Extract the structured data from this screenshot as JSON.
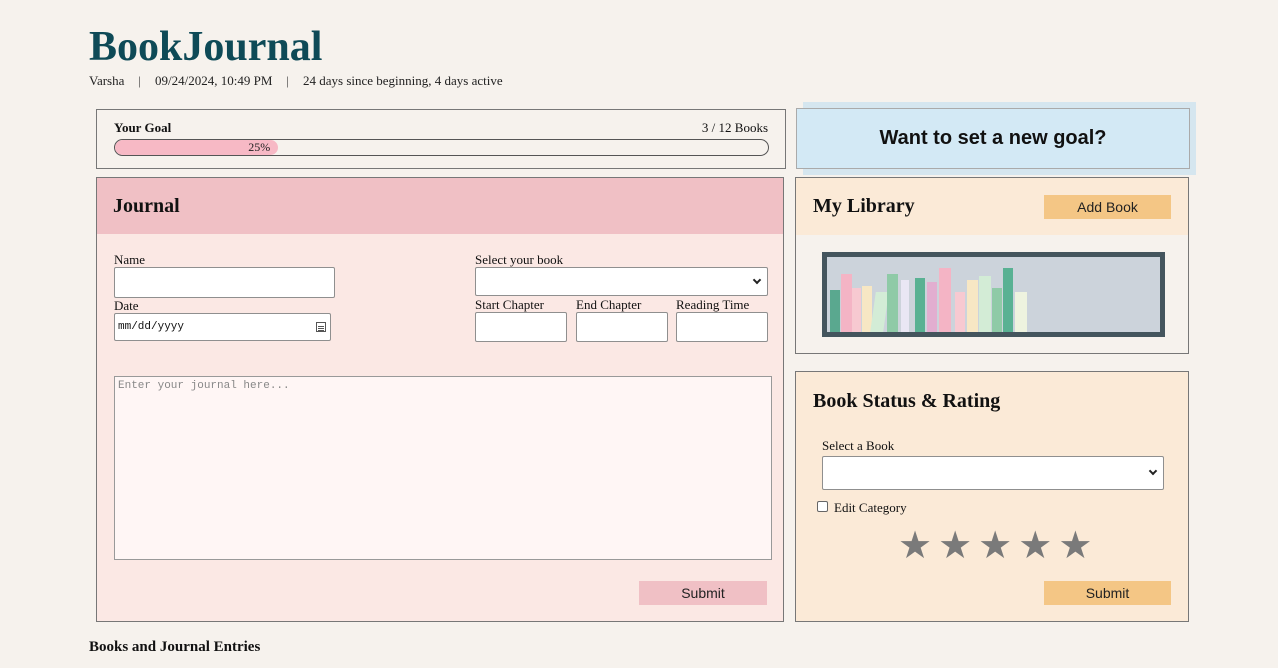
{
  "app": {
    "title": "BookJournal"
  },
  "meta": {
    "user": "Varsha",
    "separator": "|",
    "datetime": "09/24/2024, 10:49 PM",
    "stats": "24 days since beginning, 4 days active"
  },
  "goal": {
    "label": "Your Goal",
    "count": "3 / 12 Books",
    "percent_text": "25%",
    "progress": 0.25
  },
  "new_goal": {
    "label": "Want to set a new goal?"
  },
  "journal": {
    "title": "Journal",
    "name_label": "Name",
    "name_value": "",
    "date_label": "Date",
    "date_placeholder": "mm/dd/yyyy",
    "book_label": "Select your book",
    "book_value": "",
    "start_label": "Start Chapter",
    "end_label": "End Chapter",
    "time_label": "Reading Time",
    "entry_placeholder": "Enter your journal here...",
    "submit_label": "Submit"
  },
  "library": {
    "title": "My Library",
    "add_label": "Add Book"
  },
  "rating": {
    "title": "Book Status & Rating",
    "select_label": "Select a Book",
    "select_value": "",
    "edit_label": "Edit Category",
    "star_glyph": "★",
    "star_count": 5,
    "submit_label": "Submit"
  },
  "footer": {
    "heading": "Books and Journal Entries"
  },
  "colors": {
    "title": "#0e4a57",
    "background": "#f6f2ed",
    "journal_bg": "#fbe8e4",
    "journal_header": "#f0c0c5",
    "library_header": "#fbead7",
    "tan_button": "#f4c685",
    "goal_button": "#d3e9f5",
    "progress_fill": "#f7b9c5",
    "star": "#7a7a7a"
  }
}
